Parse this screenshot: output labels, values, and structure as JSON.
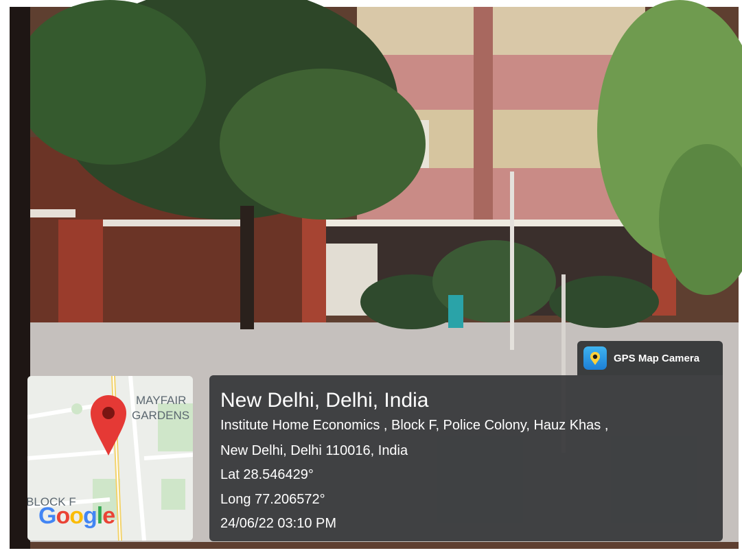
{
  "badge": {
    "label": "GPS Map Camera",
    "icon": "gps-camera-icon"
  },
  "map": {
    "labels": {
      "area_line1": "MAYFAIR",
      "area_line2": "GARDENS",
      "block": "BLOCK F"
    },
    "logo": {
      "letters": [
        "G",
        "o",
        "o",
        "g",
        "l",
        "e"
      ],
      "colors": [
        "#4285f4",
        "#ea4335",
        "#fbbc05",
        "#4285f4",
        "#34a853",
        "#ea4335"
      ]
    },
    "pin_color": "#e53935"
  },
  "info": {
    "title": "New Delhi, Delhi, India",
    "address_line1": "Institute Home Economics , Block F, Police Colony, Hauz Khas ,",
    "address_line2": "New Delhi, Delhi 110016, India",
    "lat": "Lat 28.546429°",
    "long": "Long 77.206572°",
    "datetime": "24/06/22 03:10 PM"
  }
}
